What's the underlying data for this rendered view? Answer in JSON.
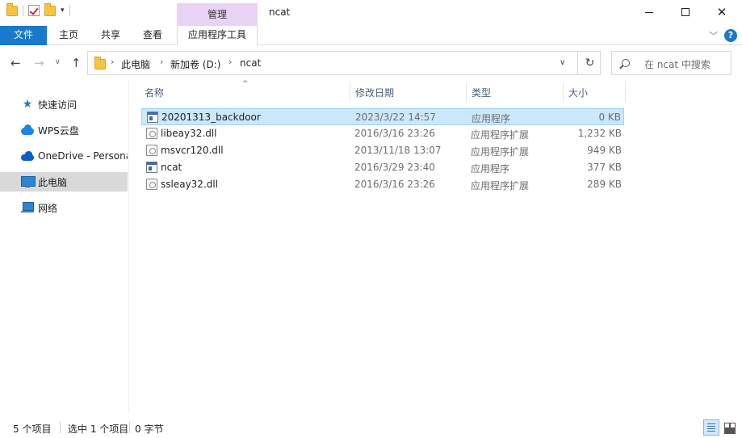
{
  "window": {
    "title": "ncat",
    "contextual_tab_group": "管理"
  },
  "ribbon": {
    "tabs": [
      {
        "label": "文件"
      },
      {
        "label": "主页"
      },
      {
        "label": "共享"
      },
      {
        "label": "查看"
      },
      {
        "label": "应用程序工具"
      }
    ]
  },
  "navigation": {
    "breadcrumb": [
      "此电脑",
      "新加卷 (D:)",
      "ncat"
    ],
    "search_placeholder": "在 ncat 中搜索"
  },
  "sidebar": {
    "items": [
      {
        "label": "快速访问",
        "icon": "star-icon"
      },
      {
        "label": "WPS云盘",
        "icon": "cloud-icon"
      },
      {
        "label": "OneDrive - Personal",
        "icon": "onedrive-icon"
      },
      {
        "label": "此电脑",
        "icon": "computer-icon",
        "selected": true
      },
      {
        "label": "网络",
        "icon": "network-icon"
      }
    ]
  },
  "file_list": {
    "columns": [
      "名称",
      "修改日期",
      "类型",
      "大小"
    ],
    "rows": [
      {
        "name": "20201313_backdoor",
        "date": "2023/3/22 14:57",
        "type": "应用程序",
        "size": "0 KB",
        "icon": "exe-icon",
        "selected": true
      },
      {
        "name": "libeay32.dll",
        "date": "2016/3/16 23:26",
        "type": "应用程序扩展",
        "size": "1,232 KB",
        "icon": "dll-icon"
      },
      {
        "name": "msvcr120.dll",
        "date": "2013/11/18 13:07",
        "type": "应用程序扩展",
        "size": "949 KB",
        "icon": "dll-icon"
      },
      {
        "name": "ncat",
        "date": "2016/3/29 23:40",
        "type": "应用程序",
        "size": "377 KB",
        "icon": "exe-icon"
      },
      {
        "name": "ssleay32.dll",
        "date": "2016/3/16 23:26",
        "type": "应用程序扩展",
        "size": "289 KB",
        "icon": "dll-icon"
      }
    ]
  },
  "status_bar": {
    "item_count": "5 个项目",
    "selection": "选中 1 个项目",
    "selection_size": "0 字节"
  },
  "colors": {
    "accent": "#1979ca",
    "contextual_tab": "#e9d3f5",
    "selection_bg": "#cce8ff",
    "selection_border": "#99d1ff"
  }
}
